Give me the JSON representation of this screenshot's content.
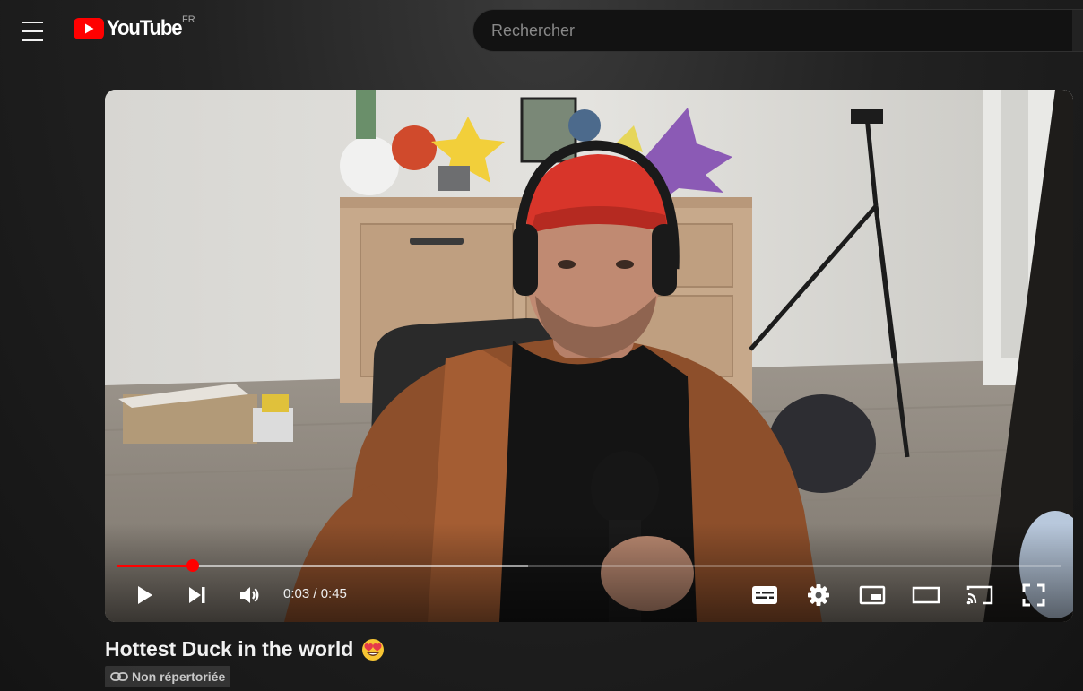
{
  "header": {
    "logo_text": "YouTube",
    "country_code": "FR",
    "search_placeholder": "Rechercher"
  },
  "player": {
    "current_time": "0:03",
    "duration": "0:45",
    "time_display": "0:03 / 0:45",
    "played_fraction": 0.08,
    "buffered_fraction": 0.435,
    "progress_color": "#ff0000",
    "controls": [
      "play-icon",
      "next-icon",
      "volume-icon",
      "subtitles-icon",
      "settings-gear-icon",
      "miniplayer-icon",
      "theater-mode-icon",
      "cast-icon",
      "fullscreen-icon"
    ]
  },
  "video": {
    "title": "Hottest Duck in the world",
    "title_emoji": "heart-eyes-emoji",
    "visibility_badge": "Non répertoriée",
    "visibility_icon": "link-icon"
  }
}
